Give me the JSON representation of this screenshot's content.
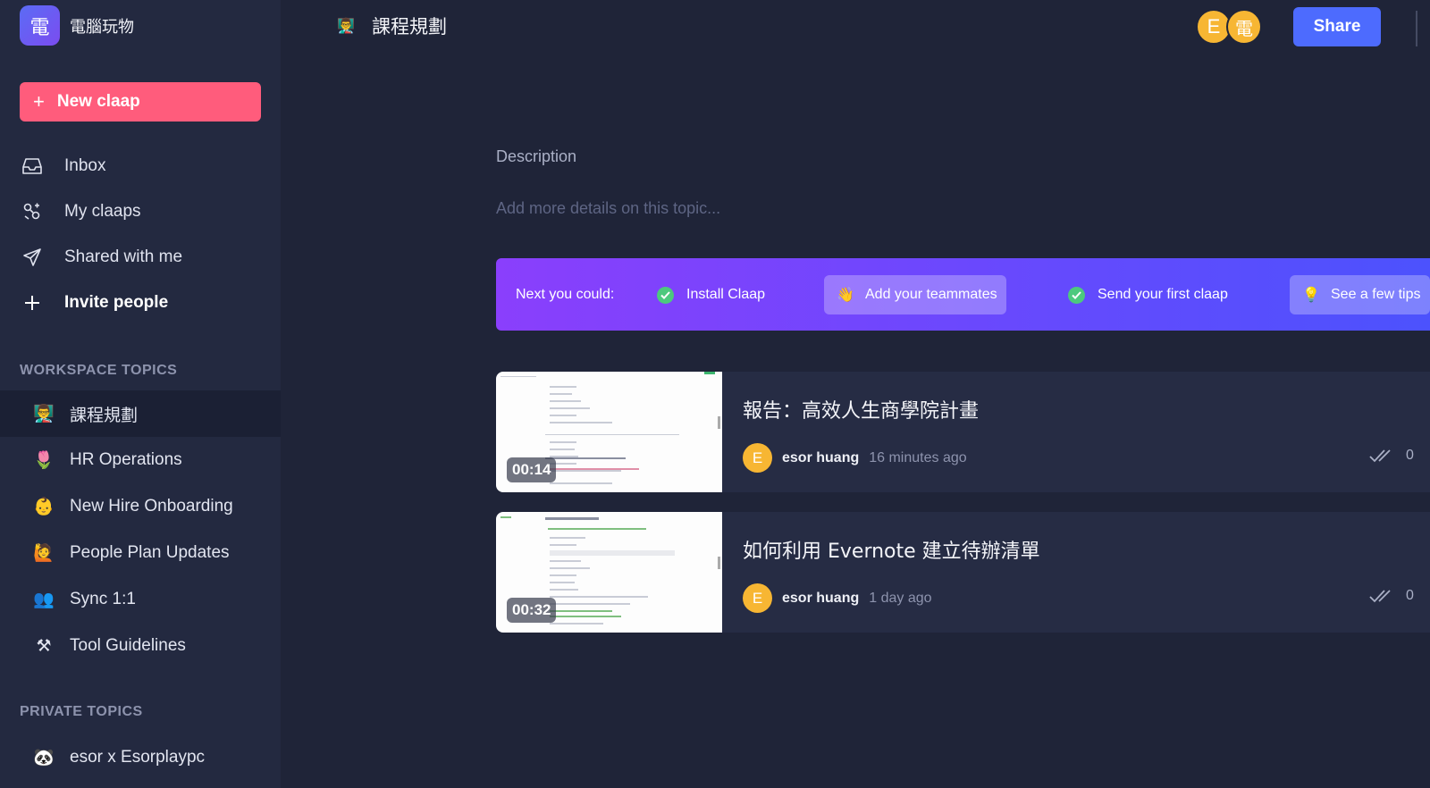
{
  "workspace": {
    "logo_char": "電",
    "name": "電腦玩物"
  },
  "sidebar": {
    "new_button": "New claap",
    "nav": [
      {
        "label": "Inbox",
        "icon": "inbox-icon"
      },
      {
        "label": "My claaps",
        "icon": "claaps-icon"
      },
      {
        "label": "Shared with me",
        "icon": "paper-plane-icon"
      },
      {
        "label": "Invite people",
        "icon": "plus-icon"
      }
    ],
    "workspace_topics_title": "WORKSPACE TOPICS",
    "workspace_topics": [
      {
        "emoji": "👨‍🏫",
        "label": "課程規劃"
      },
      {
        "emoji": "🌷",
        "label": "HR Operations"
      },
      {
        "emoji": "👶",
        "label": "New Hire Onboarding"
      },
      {
        "emoji": "🙋",
        "label": "People Plan Updates"
      },
      {
        "emoji": "👥",
        "label": "Sync 1:1"
      },
      {
        "emoji": "⚒",
        "label": "Tool Guidelines"
      }
    ],
    "private_topics_title": "PRIVATE TOPICS",
    "private_topics": [
      {
        "emoji": "🐼",
        "label": "esor x Esorplaypc"
      }
    ]
  },
  "header": {
    "emoji": "👨‍🏫",
    "title": "課程規劃",
    "avatars": [
      "E",
      "電"
    ],
    "share_label": "Share"
  },
  "description": {
    "label": "Description",
    "placeholder": "Add more details on this topic..."
  },
  "onboarding": {
    "lead": "Next you could:",
    "steps": [
      {
        "label": "Install Claap",
        "done": true
      },
      {
        "label": "Add your teammates",
        "emoji": "👋",
        "highlight": true
      },
      {
        "label": "Send your first claap",
        "done": true
      },
      {
        "label": "See a few tips",
        "emoji": "💡",
        "highlight": true
      }
    ]
  },
  "claaps": [
    {
      "title": "報告：高效人生商學院計畫",
      "duration": "00:14",
      "author_initial": "E",
      "author": "esor huang",
      "time": "16 minutes ago",
      "views": "0"
    },
    {
      "title": "如何利用 Evernote 建立待辦清單",
      "duration": "00:32",
      "author_initial": "E",
      "author": "esor huang",
      "time": "1 day ago",
      "views": "0"
    }
  ],
  "colors": {
    "background": "#1f2438",
    "sidebar": "#232940",
    "new_button": "#ff5c7c",
    "share_button": "#4d6bfe",
    "avatar": "#f7b633",
    "check": "#4cc97e"
  }
}
